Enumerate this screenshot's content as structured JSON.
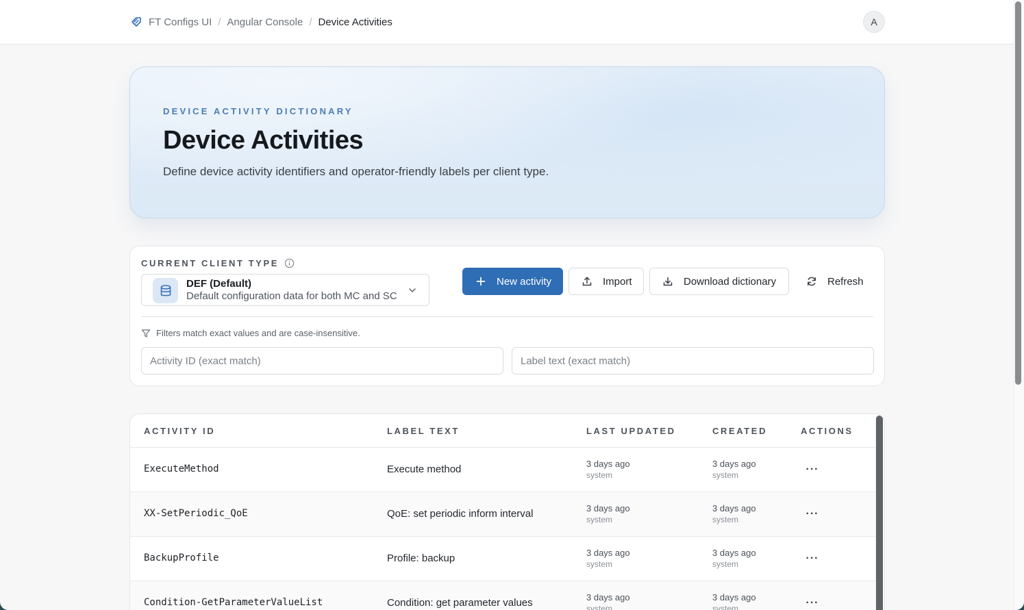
{
  "breadcrumb": {
    "items": [
      "FT Configs UI",
      "Angular Console",
      "Device Activities"
    ],
    "separator": "/"
  },
  "user": {
    "avatar_initial": "A"
  },
  "hero": {
    "eyebrow": "DEVICE ACTIVITY DICTIONARY",
    "title": "Device Activities",
    "subtitle": "Define device activity identifiers and operator-friendly labels per client type."
  },
  "client_type": {
    "label": "CURRENT CLIENT TYPE",
    "selected_name": "DEF (Default)",
    "selected_desc": "Default configuration data for both MC and SC"
  },
  "actions": {
    "new_activity": "New activity",
    "import": "Import",
    "download": "Download dictionary",
    "refresh": "Refresh"
  },
  "filters": {
    "hint": "Filters match exact values and are case-insensitive.",
    "activity_id_placeholder": "Activity ID (exact match)",
    "label_placeholder": "Label text (exact match)"
  },
  "table": {
    "columns": [
      "ACTIVITY ID",
      "LABEL TEXT",
      "LAST UPDATED",
      "CREATED",
      "ACTIONS"
    ],
    "rows": [
      {
        "id": "ExecuteMethod",
        "label": "Execute method",
        "updated": "3 days ago",
        "updated_by": "system",
        "created": "3 days ago",
        "created_by": "system"
      },
      {
        "id": "XX-SetPeriodic_QoE",
        "label": "QoE: set periodic inform interval",
        "updated": "3 days ago",
        "updated_by": "system",
        "created": "3 days ago",
        "created_by": "system"
      },
      {
        "id": "BackupProfile",
        "label": "Profile: backup",
        "updated": "3 days ago",
        "updated_by": "system",
        "created": "3 days ago",
        "created_by": "system"
      },
      {
        "id": "Condition-GetParameterValueList",
        "label": "Condition: get parameter values",
        "updated": "3 days ago",
        "updated_by": "system",
        "created": "3 days ago",
        "created_by": "system"
      }
    ],
    "row_menu": "···"
  },
  "colors": {
    "primary": "#2f6db5",
    "eyebrow": "#4a7db4",
    "hero_bg": "#dbe9f6"
  }
}
